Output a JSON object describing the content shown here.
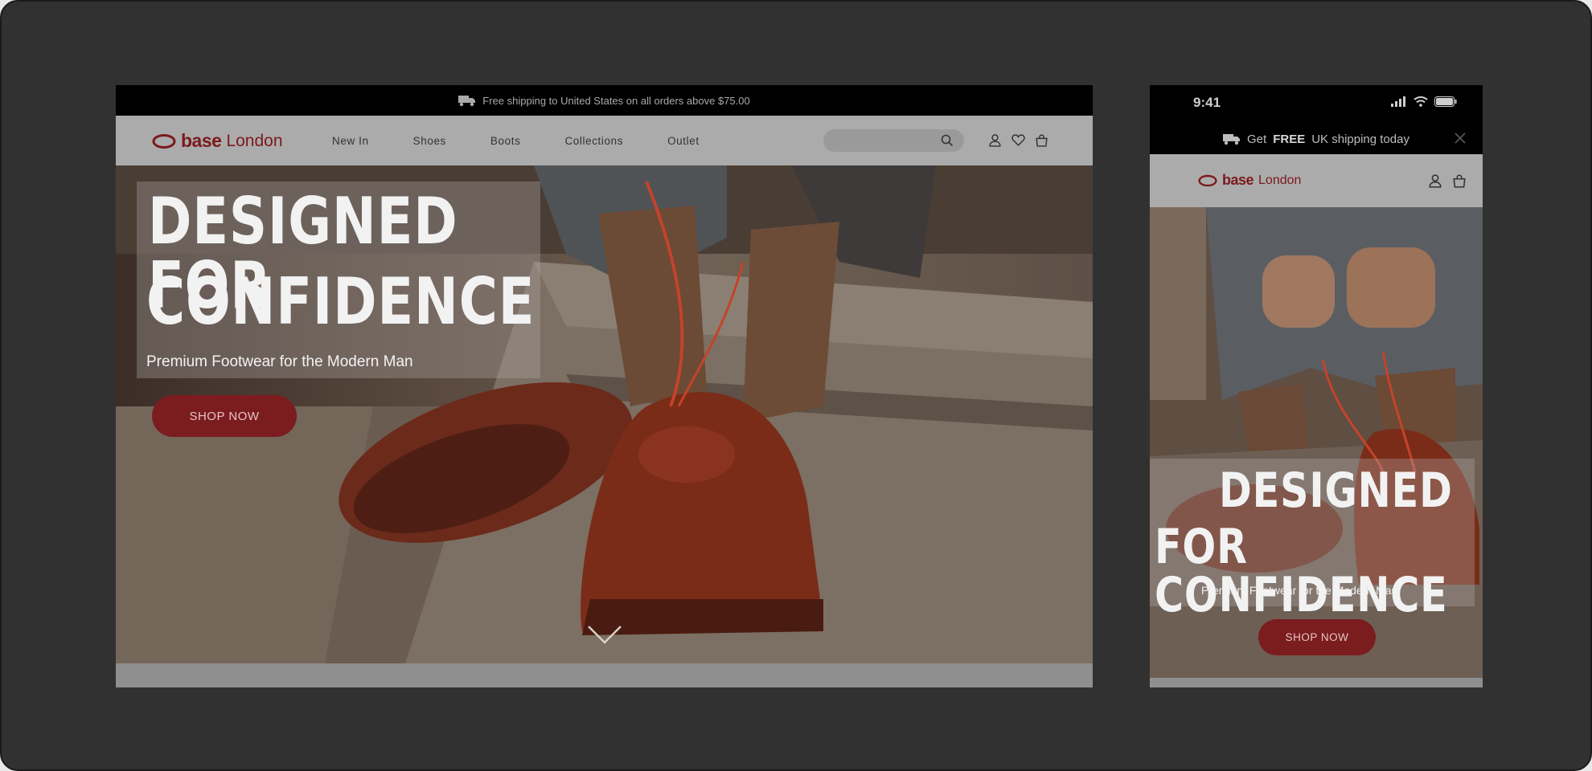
{
  "desktop": {
    "announcement": {
      "text": "Free shipping to United States on all orders above $75.00",
      "icon": "truck-icon"
    },
    "brand": {
      "bold": "base",
      "light": "London",
      "color": "#7a1a1d"
    },
    "menu": [
      {
        "label": "New In"
      },
      {
        "label": "Shoes"
      },
      {
        "label": "Boots"
      },
      {
        "label": "Collections"
      },
      {
        "label": "Outlet"
      }
    ],
    "search": {
      "placeholder": "",
      "icon": "search-icon"
    },
    "header_icons": [
      "user-icon",
      "heart-icon",
      "bag-icon"
    ],
    "hero": {
      "headline_line1": "DESIGNED FOR",
      "headline_line2": "CONFIDENCE",
      "subheadline": "Premium Footwear for the Modern Man",
      "cta": "SHOP NOW",
      "scroll_icon": "chevron-down-icon"
    }
  },
  "mobile": {
    "status": {
      "time": "9:41"
    },
    "announcement": {
      "prefix": "Get",
      "bold": "FREE",
      "suffix": "UK shipping today",
      "icon": "truck-icon"
    },
    "brand": {
      "bold": "base",
      "light": "London"
    },
    "header_icons": [
      "user-icon",
      "bag-icon"
    ],
    "hero": {
      "headline_line1": "DESIGNED",
      "headline_line2": "FOR CONFIDENCE",
      "subheadline": "Premium Footwear for the Modern Man",
      "cta": "SHOP NOW"
    }
  },
  "colors": {
    "accent": "#7b1c1f",
    "canvas": "#323132",
    "nav": "#acabab",
    "topbar": "#000000"
  }
}
